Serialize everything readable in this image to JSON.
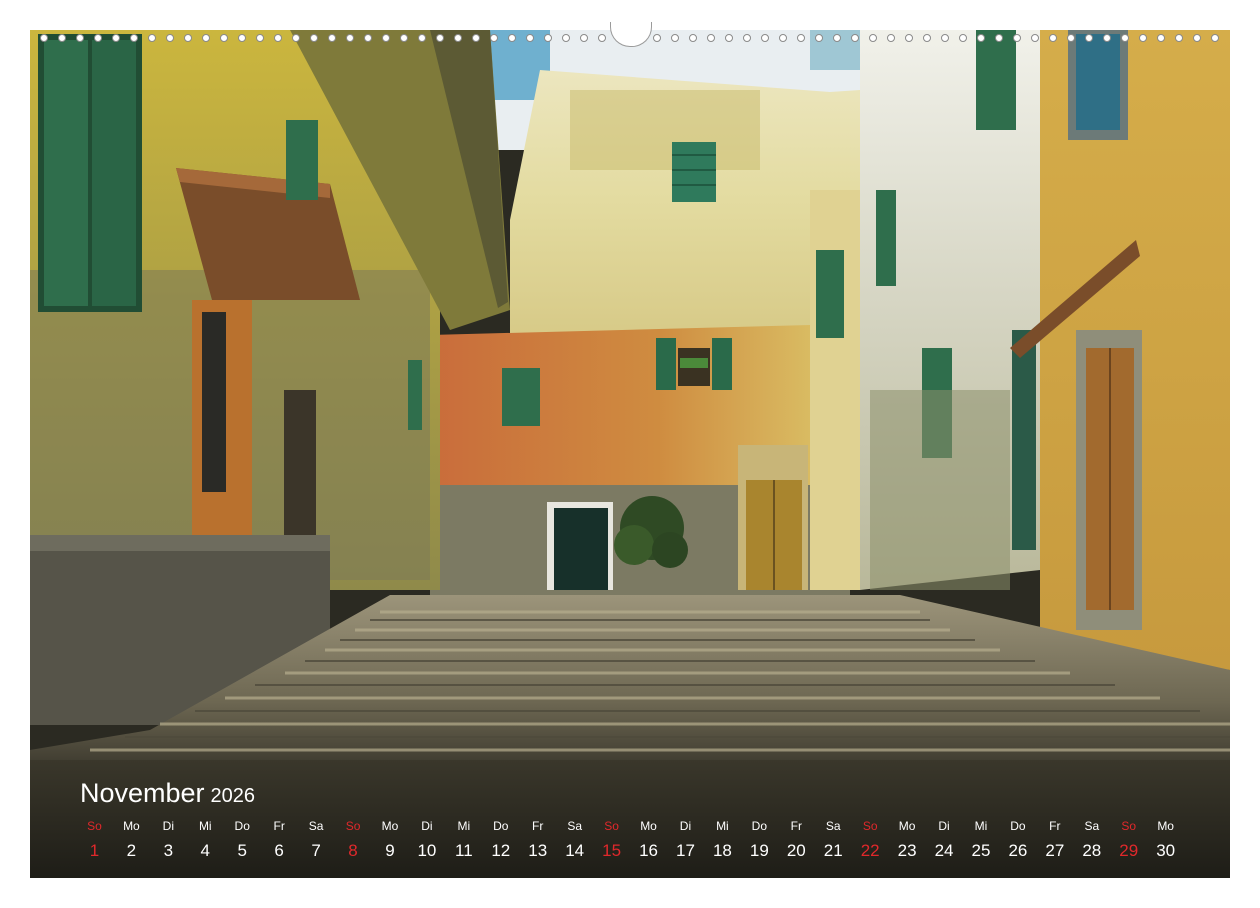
{
  "calendar": {
    "month": "November",
    "year": "2026",
    "sunday_color": "#e0282b",
    "days": [
      {
        "wd": "So",
        "d": "1",
        "sun": true
      },
      {
        "wd": "Mo",
        "d": "2"
      },
      {
        "wd": "Di",
        "d": "3"
      },
      {
        "wd": "Mi",
        "d": "4"
      },
      {
        "wd": "Do",
        "d": "5"
      },
      {
        "wd": "Fr",
        "d": "6"
      },
      {
        "wd": "Sa",
        "d": "7"
      },
      {
        "wd": "So",
        "d": "8",
        "sun": true
      },
      {
        "wd": "Mo",
        "d": "9"
      },
      {
        "wd": "Di",
        "d": "10"
      },
      {
        "wd": "Mi",
        "d": "11"
      },
      {
        "wd": "Do",
        "d": "12"
      },
      {
        "wd": "Fr",
        "d": "13"
      },
      {
        "wd": "Sa",
        "d": "14"
      },
      {
        "wd": "So",
        "d": "15",
        "sun": true
      },
      {
        "wd": "Mo",
        "d": "16"
      },
      {
        "wd": "Di",
        "d": "17"
      },
      {
        "wd": "Mi",
        "d": "18"
      },
      {
        "wd": "Do",
        "d": "19"
      },
      {
        "wd": "Fr",
        "d": "20"
      },
      {
        "wd": "Sa",
        "d": "21"
      },
      {
        "wd": "So",
        "d": "22",
        "sun": true
      },
      {
        "wd": "Mo",
        "d": "23"
      },
      {
        "wd": "Di",
        "d": "24"
      },
      {
        "wd": "Mi",
        "d": "25"
      },
      {
        "wd": "Do",
        "d": "26"
      },
      {
        "wd": "Fr",
        "d": "27"
      },
      {
        "wd": "Sa",
        "d": "28"
      },
      {
        "wd": "So",
        "d": "29",
        "sun": true
      },
      {
        "wd": "Mo",
        "d": "30"
      }
    ]
  },
  "photo": {
    "subject": "narrow-alley-stone-steps",
    "colors": {
      "yellow_wall": "#c9b23c",
      "shutter_green": "#2f6e4c",
      "orange_wall": "#c9793a",
      "stone": "#8c8366",
      "sky": "#e8eef0"
    }
  }
}
